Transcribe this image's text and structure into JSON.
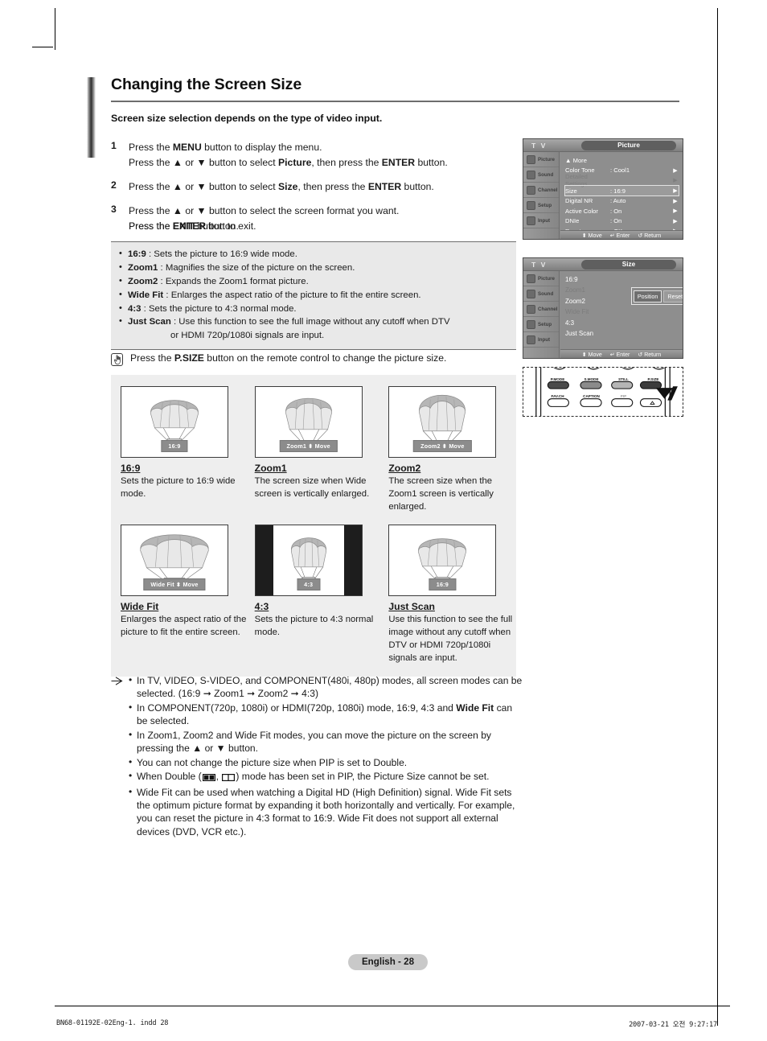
{
  "page": {
    "title": "Changing the Screen Size",
    "subtitle": "Screen size selection depends on the type of video input.",
    "footer_page": "English - 28",
    "footer_left": "BN68-01192E-02Eng-1. indd     28",
    "footer_right": "2007-03-21   오전 9:27:17"
  },
  "steps": [
    {
      "num": "1",
      "lines": [
        "Press the <b>MENU</b> button to display the menu.",
        "Press the ▲ or ▼ button to select <b>Picture</b>, then press the <b>ENTER</b> button."
      ]
    },
    {
      "num": "2",
      "lines": [
        "Press the ▲ or ▼ button to select <b>Size</b>, then press the <b>ENTER</b> button."
      ]
    },
    {
      "num": "3",
      "lines": [
        "Press the ▲ or ▼ button to select the screen format you want.",
        "Press the <b>ENTER</b> button."
      ]
    }
  ],
  "exit_line": "Press the <b>EXIT</b> button to exit.",
  "definitions": [
    {
      "term": "16:9",
      "text": " : Sets the picture to 16:9 wide mode."
    },
    {
      "term": "Zoom1",
      "text": " : Magnifies the size of the picture on the screen."
    },
    {
      "term": "Zoom2",
      "text": " : Expands the Zoom1 format picture."
    },
    {
      "term": "Wide Fit",
      "text": " : Enlarges the aspect ratio of the picture to fit the entire screen."
    },
    {
      "term": "4:3",
      "text": " : Sets the picture to 4:3 normal mode."
    },
    {
      "term": "Just Scan",
      "text": " : Use this function to see the full image without any cutoff when DTV"
    }
  ],
  "definition_continuation": "or HDMI 720p/1080i signals are input.",
  "psize_note": "Press the <b>P.SIZE</b> button on the remote control to change the picture size.",
  "examples": [
    {
      "tag": "16:9",
      "label": "16:9",
      "desc": "Sets the picture to 16:9 wide mode.",
      "style": "plain"
    },
    {
      "tag": "Zoom1 ⬍ Move",
      "label": "Zoom1",
      "desc": "The screen size when Wide screen is vertically enlarged.",
      "style": "plain"
    },
    {
      "tag": "Zoom2 ⬍ Move",
      "label": "Zoom2",
      "desc": "The screen size when the Zoom1 screen is vertically enlarged.",
      "style": "plain"
    },
    {
      "tag": "Wide Fit ⬍ Move",
      "label": "Wide Fit",
      "desc": "Enlarges the aspect ratio of the picture to fit the entire screen.",
      "style": "plain"
    },
    {
      "tag": "4:3",
      "label": "4:3",
      "desc": "Sets the picture to 4:3 normal mode.",
      "style": "pillarbox"
    },
    {
      "tag": "16:9",
      "label": "Just Scan",
      "desc": "Use this function to see the full image without any cutoff when DTV or HDMI 720p/1080i signals are input.",
      "style": "plain"
    }
  ],
  "notes": [
    "In TV, VIDEO, S-VIDEO, and COMPONENT(480i, 480p) modes, all screen modes can be selected. (16:9 ➞ Zoom1 ➞ Zoom2 ➞ 4:3)",
    "In COMPONENT(720p, 1080i) or HDMI(720p, 1080i) mode, 16:9, 4:3 and <b>Wide Fit</b> can be selected.",
    "In Zoom1, Zoom2 and Wide Fit modes, you can move the picture on the screen by pressing the ▲ or ▼ button.",
    "You can not change the picture size when PIP is set to Double.",
    "When Double (<span class=\"dbl-icon\" data-name=\"double-pip-icon-a\"></span>, <span class=\"dbl-icon\" data-name=\"double-pip-icon-b\"></span>) mode has been set in PIP, the Picture Size cannot be set.",
    "Wide Fit can be used when watching a Digital HD (High Definition) signal. Wide Fit sets the optimum picture format by expanding it both horizontally and vertically. For example, you can reset the picture in 4:3 format to 16:9. Wide Fit does not support all external devices (DVD, VCR etc.)."
  ],
  "osd_picture": {
    "device_label": "T V",
    "title": "Picture",
    "sidebar": [
      "Picture",
      "Sound",
      "Channel",
      "Setup",
      "Input"
    ],
    "rows": [
      {
        "name": "▲  More",
        "value": "",
        "arrow": "",
        "state": "normal"
      },
      {
        "name": "Color Tone",
        "value": ": Cool1",
        "arrow": "▶",
        "state": "normal"
      },
      {
        "name": "Detailed Settings",
        "value": "",
        "arrow": "▶",
        "state": "dim"
      },
      {
        "name": "Size",
        "value": ": 16:9",
        "arrow": "▶",
        "state": "highlight"
      },
      {
        "name": "Digital NR",
        "value": ": Auto",
        "arrow": "▶",
        "state": "normal"
      },
      {
        "name": "Active Color",
        "value": ": On",
        "arrow": "▶",
        "state": "normal"
      },
      {
        "name": "DNIe",
        "value": ": On",
        "arrow": "▶",
        "state": "normal"
      },
      {
        "name": "Reset",
        "value": ": OK",
        "arrow": "▶",
        "state": "normal"
      }
    ],
    "hints": [
      "Move",
      "Enter",
      "Return"
    ]
  },
  "osd_size": {
    "device_label": "T V",
    "title": "Size",
    "sidebar": [
      "Picture",
      "Sound",
      "Channel",
      "Setup",
      "Input"
    ],
    "items": [
      {
        "label": "16:9",
        "state": "normal"
      },
      {
        "label": "Zoom1",
        "state": "dim"
      },
      {
        "label": "Zoom2",
        "state": "normal"
      },
      {
        "label": "Wide Fit",
        "state": "dim"
      },
      {
        "label": "4:3",
        "state": "normal"
      },
      {
        "label": "Just Scan",
        "state": "normal"
      }
    ],
    "position_button": "Position",
    "reset_button": "Reset",
    "hints": [
      "Move",
      "Enter",
      "Return"
    ]
  },
  "remote": {
    "row1": [
      "P.MODE",
      "S.MODE",
      "STILL",
      "P.SIZE"
    ],
    "row2": [
      "FAV.CH",
      "CAPTION",
      "PIP",
      "∧"
    ]
  },
  "colors": {
    "osd_bg": "#8e8e8e",
    "box_bg": "#e9e9e9",
    "examples_bg": "#eeeeee",
    "pill_bg": "#c9c9c9",
    "rule": "#6d6d6d"
  }
}
